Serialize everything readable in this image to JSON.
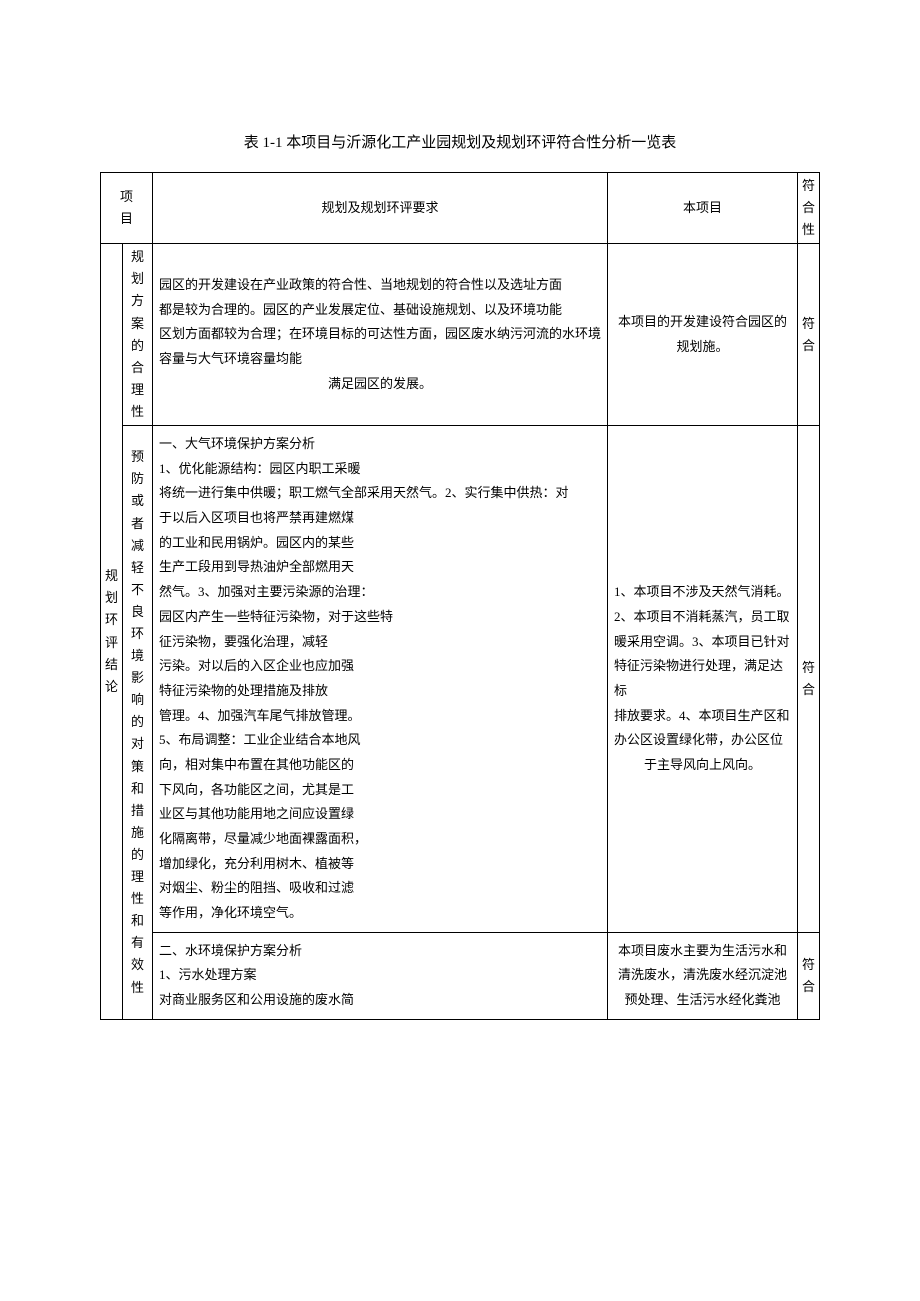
{
  "title": "表 1-1 本项目与沂源化工产业园规划及规划环评符合性分析一览表",
  "header": {
    "col1": "项目",
    "col2": "规划及规划环评要求",
    "col3": "本项目",
    "col4": "符合性"
  },
  "row1_label": "规划环评结论",
  "r1": {
    "sub": "规划方案的合理性",
    "req": "园区的开发建设在产业政策的符合性、当地规划的符合性以及选址方面都是较为合理的。园区的产业发展定位、基础设施规划、以及环境功能区划方面都较为合理；在环境目标的可达性方面，园区废水纳污河流的水环境容量与大气环境容量均能满足园区的发展。",
    "req_p1": "园区的开发建设在产业政策的符合性、当地规划的符合性以及选址方面",
    "req_p2": "都是较为合理的。园区的产业发展定位、基础设施规划、以及环境功能",
    "req_p3": "区划方面都较为合理；在环境目标的可达性方面，园区废水纳污河流的水环境容量与大气环境容量均能",
    "req_p4": "满足园区的发展。",
    "proj": "本项目的开发建设符合园区的规划施。",
    "conf": "符合"
  },
  "r2": {
    "sub": "预防或者减轻不良环境影响的对策和措施的理性和有效性",
    "req_l1": "一、大气环境保护方案分析",
    "req_l2": "1、优化能源结构：园区内职工采暖",
    "req_l3": "将统一进行集中供暖；职工燃气全部采用天然气。2、实行集中供热：对",
    "req_l4": "于以后入区项目也将严禁再建燃煤",
    "req_l5": "的工业和民用锅炉。园区内的某些",
    "req_l6": "生产工段用到导热油炉全部燃用天",
    "req_l7": "然气。3、加强对主要污染源的治理：",
    "req_l8": "园区内产生一些特征污染物，对于这些特",
    "req_l9": "征污染物，要强化治理，减轻",
    "req_l10": "污染。对以后的入区企业也应加强",
    "req_l11": "特征污染物的处理措施及排放",
    "req_l12": "管理。4、加强汽车尾气排放管理。",
    "req_l13": "5、布局调整：工业企业结合本地风",
    "req_l14": "向，相对集中布置在其他功能区的",
    "req_l15": "下风向，各功能区之间，尤其是工",
    "req_l16": "业区与其他功能用地之间应设置绿",
    "req_l17": "化隔离带，尽量减少地面裸露面积，",
    "req_l18": "增加绿化，充分利用树木、植被等",
    "req_l19": "对烟尘、粉尘的阻挡、吸收和过滤",
    "req_l20": "等作用，净化环境空气。",
    "proj_l1": "1、本项目不涉及天然气消耗。",
    "proj_l2": "2、本项目不消耗蒸汽，员工取暖采用空调。3、本项目已针对",
    "proj_l3": "特征污染物进行处理，满足达标",
    "proj_l4": "排放要求。4、本项目生产区和",
    "proj_l5": "办公区设置绿化带，办公区位",
    "proj_l6": "于主导风向上风向。",
    "conf": "符合"
  },
  "r3": {
    "req_l1": "二、水环境保护方案分析",
    "req_l2": "1、污水处理方案",
    "req_l3": "对商业服务区和公用设施的废水简",
    "proj": "本项目废水主要为生活污水和清洗废水，清洗废水经沉淀池预处理、生活污水经化粪池",
    "conf": "符合"
  }
}
